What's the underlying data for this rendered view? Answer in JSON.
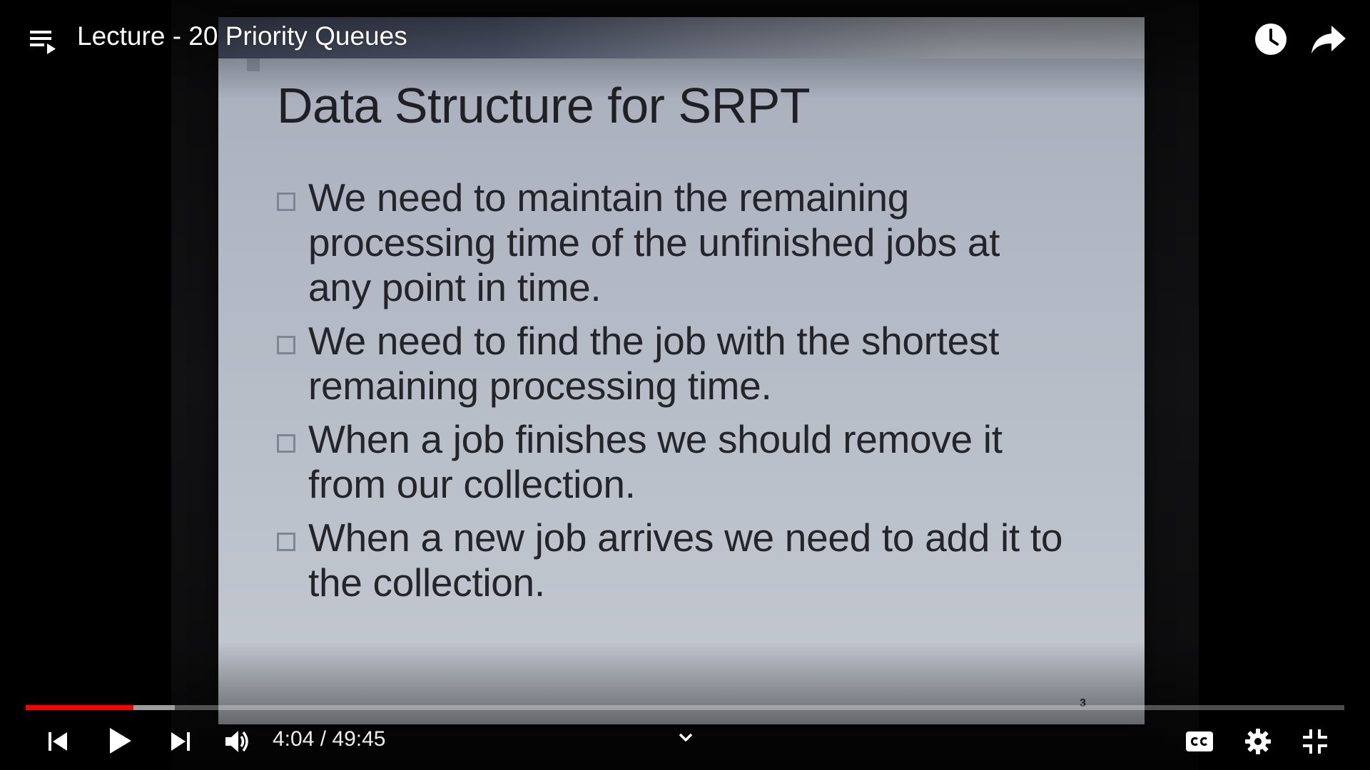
{
  "player": {
    "title": "Lecture - 20 Priority Queues",
    "time_current": "4:04",
    "time_total": "49:45",
    "time_display": "4:04 / 49:45",
    "progress_played_fraction": 0.0818,
    "progress_buffered_fraction": 0.1132,
    "colors": {
      "progress_played": "#ff0000",
      "controls": "#ffffff"
    },
    "icons": {
      "playlist": "playlist-icon",
      "watch_later": "clock-icon",
      "share": "share-arrow-icon",
      "previous": "skip-previous-icon",
      "play": "play-icon",
      "next": "skip-next-icon",
      "volume": "volume-icon",
      "more": "chevron-down-icon",
      "captions": "cc-icon",
      "settings": "gear-icon",
      "fullscreen_exit": "exit-fullscreen-icon"
    }
  },
  "slide": {
    "title": "Data Structure for SRPT",
    "bullets": [
      "We need to maintain the remaining processing time of the unfinished jobs at any point in time.",
      "We need to find the job with the shortest remaining processing time.",
      "When a job finishes we should remove it from our collection.",
      "When a new job arrives we need to add it to the collection."
    ],
    "page_number": "3"
  }
}
